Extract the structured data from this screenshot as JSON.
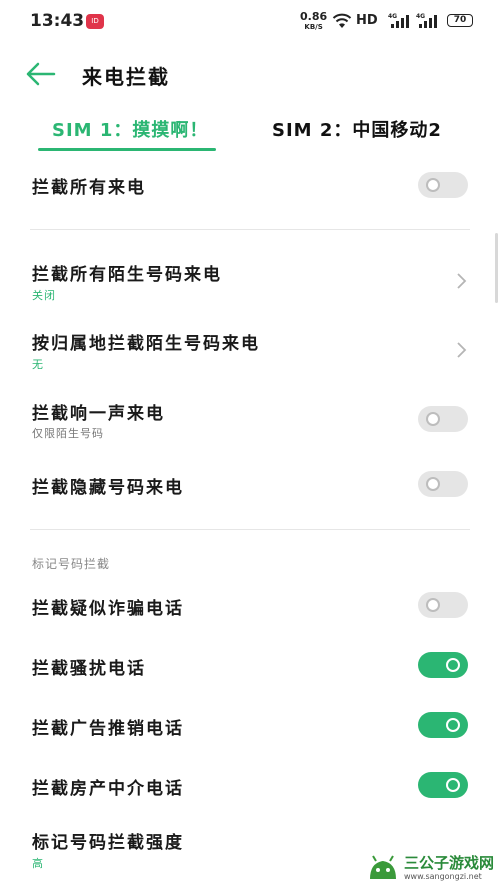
{
  "status_bar": {
    "time": "13:43",
    "notification_badge": "ID",
    "net_speed": "0.86",
    "net_speed_unit": "KB/S",
    "hd": "HD",
    "network_1": "4G",
    "network_2": "4G",
    "battery": "70"
  },
  "header": {
    "title": "来电拦截"
  },
  "tabs": [
    {
      "label": "SIM 1：摸摸啊！",
      "active": true
    },
    {
      "label": "SIM 2：中国移动2",
      "active": false
    }
  ],
  "rows": {
    "block_all": {
      "title": "拦截所有来电",
      "toggle_on": false
    },
    "block_strangers": {
      "title": "拦截所有陌生号码来电",
      "sub": "关闭"
    },
    "block_by_region": {
      "title": "按归属地拦截陌生号码来电",
      "sub": "无"
    },
    "block_one_ring": {
      "title": "拦截响一声来电",
      "sub": "仅限陌生号码",
      "toggle_on": false
    },
    "block_hidden": {
      "title": "拦截隐藏号码来电",
      "toggle_on": false
    }
  },
  "tagged_section": {
    "label": "标记号码拦截",
    "items": {
      "fraud": {
        "title": "拦截疑似诈骗电话",
        "toggle_on": false
      },
      "harassment": {
        "title": "拦截骚扰电话",
        "toggle_on": true
      },
      "ads": {
        "title": "拦截广告推销电话",
        "toggle_on": true
      },
      "real_estate": {
        "title": "拦截房产中介电话",
        "toggle_on": true
      },
      "strength": {
        "title": "标记号码拦截强度",
        "sub": "高"
      }
    }
  },
  "watermark": {
    "name": "三公子游戏网",
    "url": "www.sangongzi.net"
  },
  "colors": {
    "accent": "#2bb673",
    "toggle_off": "#e5e5e5"
  }
}
